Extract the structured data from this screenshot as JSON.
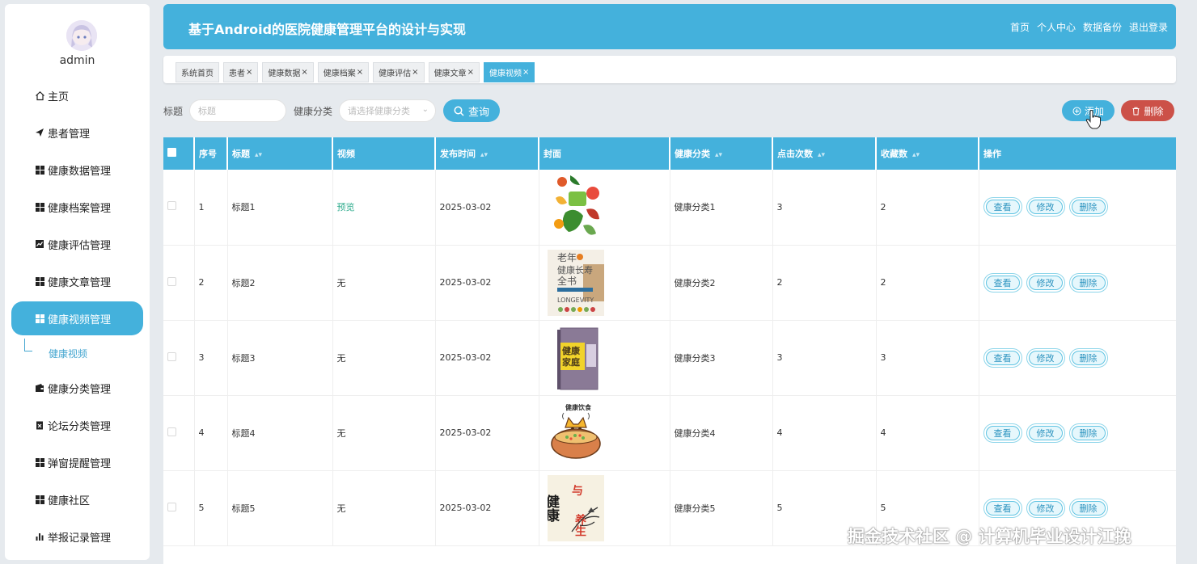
{
  "sidebar": {
    "username": "admin",
    "items": [
      {
        "label": "主页",
        "icon": "home-icon"
      },
      {
        "label": "患者管理",
        "icon": "send-icon"
      },
      {
        "label": "健康数据管理",
        "icon": "grid-icon"
      },
      {
        "label": "健康档案管理",
        "icon": "grid-icon"
      },
      {
        "label": "健康评估管理",
        "icon": "chart-icon"
      },
      {
        "label": "健康文章管理",
        "icon": "grid-icon"
      },
      {
        "label": "健康视频管理",
        "icon": "grid-icon"
      },
      {
        "label": "健康分类管理",
        "icon": "wallet-icon"
      },
      {
        "label": "论坛分类管理",
        "icon": "clipboard-icon"
      },
      {
        "label": "弹窗提醒管理",
        "icon": "grid-icon"
      },
      {
        "label": "健康社区",
        "icon": "grid-icon"
      },
      {
        "label": "举报记录管理",
        "icon": "bar-chart-icon"
      }
    ],
    "sub_item": "健康视频"
  },
  "header": {
    "title": "基于Android的医院健康管理平台的设计与实现",
    "links": [
      "首页",
      "个人中心",
      "数据备份",
      "退出登录"
    ]
  },
  "tags": [
    "系统首页",
    "患者",
    "健康数据",
    "健康档案",
    "健康评估",
    "健康文章",
    "健康视频"
  ],
  "search": {
    "title_label": "标题",
    "title_placeholder": "标题",
    "category_label": "健康分类",
    "category_placeholder": "请选择健康分类",
    "query_button": "查询",
    "add_button": "添加",
    "delete_button": "删除"
  },
  "table": {
    "headers": [
      "序号",
      "标题",
      "视频",
      "发布时间",
      "封面",
      "健康分类",
      "点击次数",
      "收藏数",
      "操作"
    ],
    "rows": [
      {
        "no": "1",
        "title": "标题1",
        "video": "预览",
        "date": "2025-03-02",
        "category": "健康分类1",
        "clicks": "3",
        "favorites": "2"
      },
      {
        "no": "2",
        "title": "标题2",
        "video": "无",
        "date": "2025-03-02",
        "category": "健康分类2",
        "clicks": "2",
        "favorites": "2"
      },
      {
        "no": "3",
        "title": "标题3",
        "video": "无",
        "date": "2025-03-02",
        "category": "健康分类3",
        "clicks": "3",
        "favorites": "3"
      },
      {
        "no": "4",
        "title": "标题4",
        "video": "无",
        "date": "2025-03-02",
        "category": "健康分类4",
        "clicks": "4",
        "favorites": "4"
      },
      {
        "no": "5",
        "title": "标题5",
        "video": "无",
        "date": "2025-03-02",
        "category": "健康分类5",
        "clicks": "5",
        "favorites": "5"
      }
    ],
    "actions": [
      "查看",
      "修改",
      "删除"
    ],
    "cover_texts": {
      "c2_line1": "老年",
      "c2_line2": "健康长寿",
      "c2_line3": "全书",
      "c2_line4": "LONGEVITY",
      "c3_line1": "健康",
      "c3_line2": "家庭",
      "c4_line1": "健康饮食",
      "c5_line1": "健康",
      "c5_line2": "与",
      "c5_line3": "养生"
    }
  },
  "watermark": "掘金技术社区 @ 计算机毕业设计江挽",
  "colors": {
    "accent": "#44b1dc",
    "danger": "#cc5148",
    "preview": "#2dab8c"
  }
}
